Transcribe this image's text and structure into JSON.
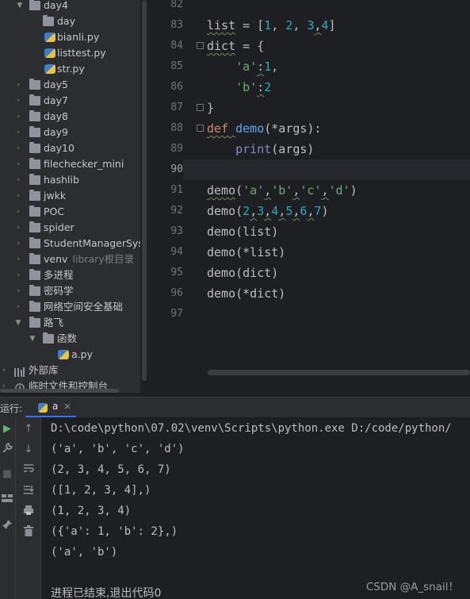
{
  "project_tree": {
    "items": [
      {
        "label": "day4",
        "type": "folder",
        "expanded": true,
        "hint": ""
      },
      {
        "label": "day",
        "type": "folder",
        "expanded": false,
        "hint": ""
      },
      {
        "label": "bianli.py",
        "type": "python-file",
        "hint": ""
      },
      {
        "label": "listtest.py",
        "type": "python-file",
        "hint": ""
      },
      {
        "label": "str.py",
        "type": "python-file",
        "hint": ""
      },
      {
        "label": "day5",
        "type": "folder",
        "expanded": false,
        "hint": ""
      },
      {
        "label": "day7",
        "type": "folder",
        "expanded": false,
        "hint": ""
      },
      {
        "label": "day8",
        "type": "folder",
        "expanded": false,
        "hint": ""
      },
      {
        "label": "day9",
        "type": "folder",
        "expanded": false,
        "hint": ""
      },
      {
        "label": "day10",
        "type": "folder",
        "expanded": false,
        "hint": ""
      },
      {
        "label": "filechecker_mini",
        "type": "folder",
        "expanded": false,
        "hint": ""
      },
      {
        "label": "hashlib",
        "type": "folder",
        "expanded": false,
        "hint": ""
      },
      {
        "label": "jwkk",
        "type": "folder",
        "expanded": false,
        "hint": ""
      },
      {
        "label": "POC",
        "type": "folder",
        "expanded": false,
        "hint": ""
      },
      {
        "label": "spider",
        "type": "folder",
        "expanded": false,
        "hint": ""
      },
      {
        "label": "StudentManagerSystem",
        "type": "folder",
        "expanded": false,
        "hint": ""
      },
      {
        "label": "venv",
        "type": "folder",
        "expanded": false,
        "hint": "library根目录"
      },
      {
        "label": "多进程",
        "type": "folder",
        "expanded": false,
        "hint": ""
      },
      {
        "label": "密码学",
        "type": "folder",
        "expanded": false,
        "hint": ""
      },
      {
        "label": "网络空间安全基础",
        "type": "folder",
        "expanded": false,
        "hint": ""
      },
      {
        "label": "路飞",
        "type": "folder",
        "expanded": true,
        "hint": ""
      },
      {
        "label": "函数",
        "type": "folder",
        "expanded": true,
        "hint": ""
      },
      {
        "label": "a.py",
        "type": "python-file",
        "hint": ""
      },
      {
        "label": "外部库",
        "type": "library",
        "expanded": false,
        "hint": ""
      },
      {
        "label": "临时文件和控制台",
        "type": "scratch",
        "expanded": false,
        "hint": ""
      }
    ]
  },
  "editor": {
    "line_numbers": [
      "82",
      "83",
      "84",
      "85",
      "86",
      "87",
      "88",
      "89",
      "90",
      "91",
      "92",
      "93",
      "94",
      "95",
      "96",
      "97"
    ],
    "current_line": "90",
    "line83": {
      "a": "list",
      "b": " = [",
      "c": "1",
      "d": ", ",
      "e": "2",
      "f": ", ",
      "g": "3",
      "h": ",",
      "i": "4",
      "j": "]"
    },
    "line84": {
      "a": "dict",
      "b": " = {"
    },
    "line85": {
      "a": "    ",
      "b": "'a'",
      "c": ":",
      "d": "1",
      "e": ","
    },
    "line86": {
      "a": "    ",
      "b": "'b'",
      "c": ":",
      "d": "2"
    },
    "line87": {
      "a": "}"
    },
    "line88": {
      "a": "def ",
      "b": "demo",
      "c": "(",
      "d": "*args",
      "e": "):"
    },
    "line89": {
      "a": "    ",
      "b": "print",
      "c": "(args)"
    },
    "line91": {
      "a": "demo",
      "b": "(",
      "c": "'a'",
      "d": ",",
      "e": "'b'",
      "f": ",",
      "g": "'c'",
      "h": ",",
      "i": "'d'",
      "j": ")"
    },
    "line92": {
      "a": "demo",
      "b": "(",
      "c": "2",
      "d": ",",
      "e": "3",
      "f": ",",
      "g": "4",
      "h": ",",
      "i": "5",
      "j": ",",
      "k": "6",
      "l": ",",
      "m": "7",
      "n": ")"
    },
    "line93": {
      "a": "demo",
      "b": "(list)"
    },
    "line94": {
      "a": "demo",
      "b": "(*list)"
    },
    "line95": {
      "a": "demo",
      "b": "(dict)"
    },
    "line96": {
      "a": "demo",
      "b": "(*dict)"
    }
  },
  "run_panel": {
    "label": "运行:",
    "tab_label": "a",
    "tab_close": "×",
    "output": [
      "D:\\code\\python\\07.02\\venv\\Scripts\\python.exe D:/code/python/",
      "('a', 'b', 'c', 'd')",
      "(2, 3, 4, 5, 6, 7)",
      "([1, 2, 3, 4],)",
      "(1, 2, 3, 4)",
      "({'a': 1, 'b': 2},)",
      "('a', 'b')",
      "",
      "进程已结束,退出代码0"
    ]
  },
  "watermark": "CSDN @A_snail！",
  "colors": {
    "keyword": "#cf8e6d",
    "function": "#56a8f5",
    "builtin": "#8888c6",
    "string": "#6aab73",
    "number": "#2aacb8",
    "tab_underline": "#3574f0",
    "run_icon": "#5fb865"
  }
}
